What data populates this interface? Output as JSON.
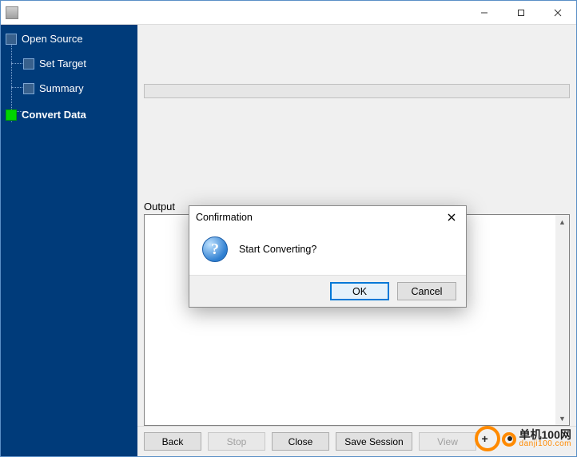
{
  "window": {
    "title": ""
  },
  "sidebar": {
    "items": [
      {
        "label": "Open Source",
        "active": false
      },
      {
        "label": "Set Target",
        "active": false
      },
      {
        "label": "Summary",
        "active": false
      },
      {
        "label": "Convert Data",
        "active": true
      }
    ]
  },
  "main": {
    "output_label": "Output"
  },
  "footer": {
    "back": "Back",
    "stop": "Stop",
    "close": "Close",
    "save_session": "Save Session",
    "view": "View"
  },
  "dialog": {
    "title": "Confirmation",
    "message": "Start Converting?",
    "ok": "OK",
    "cancel": "Cancel"
  },
  "watermark": {
    "cn": "单机100网",
    "url": "danji100.com"
  }
}
